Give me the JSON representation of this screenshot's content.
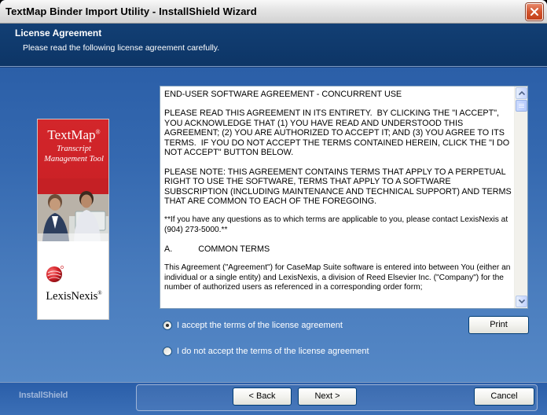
{
  "window": {
    "title": "TextMap Binder Import Utility - InstallShield Wizard"
  },
  "header": {
    "title": "License Agreement",
    "subtitle": "Please read the following license agreement carefully."
  },
  "banner": {
    "brand": "TextMap",
    "brand_mark": "®",
    "tagline_1": "Transcript",
    "tagline_2": "Management Tool",
    "company": "LexisNexis",
    "company_mark": "®"
  },
  "license": {
    "paragraphs": [
      "END-USER SOFTWARE AGREEMENT - CONCURRENT USE",
      "PLEASE READ THIS AGREEMENT IN ITS ENTIRETY.  BY CLICKING THE \"I ACCEPT\", YOU ACKNOWLEDGE THAT (1) YOU HAVE READ AND UNDERSTOOD THIS AGREEMENT; (2) YOU ARE AUTHORIZED TO ACCEPT IT; AND (3) YOU AGREE TO ITS TERMS.  IF YOU DO NOT ACCEPT THE TERMS CONTAINED HEREIN, CLICK THE \"I DO NOT ACCEPT\" BUTTON BELOW.",
      "PLEASE NOTE: THIS AGREEMENT CONTAINS TERMS THAT APPLY TO A PERPETUAL RIGHT TO USE THE SOFTWARE, TERMS THAT APPLY TO A SOFTWARE SUBSCRIPTION (INCLUDING MAINTENANCE AND TECHNICAL SUPPORT) AND TERMS THAT ARE COMMON TO EACH OF THE FOREGOING.",
      "**If you have any questions as to which terms are applicable to you, please contact LexisNexis at (904) 273-5000.**",
      "A.           COMMON TERMS",
      "This Agreement (\"Agreement\") for CaseMap Suite software is entered into between You (either an individual or a single entity) and LexisNexis, a division of Reed Elsevier Inc. (\"Company\") for the number of authorized users as referenced in a corresponding order form;"
    ]
  },
  "options": {
    "accept_label": "I accept the terms of the license agreement",
    "decline_label": "I do not accept the terms of the license agreement",
    "selected": "accept"
  },
  "buttons": {
    "print": "Print",
    "back": "< Back",
    "next": "Next >",
    "cancel": "Cancel"
  },
  "footer": {
    "brand": "InstallShield"
  },
  "colors": {
    "header_bg": "#0d3566",
    "body_bg": "#3569b0",
    "banner_red": "#c51d22"
  }
}
